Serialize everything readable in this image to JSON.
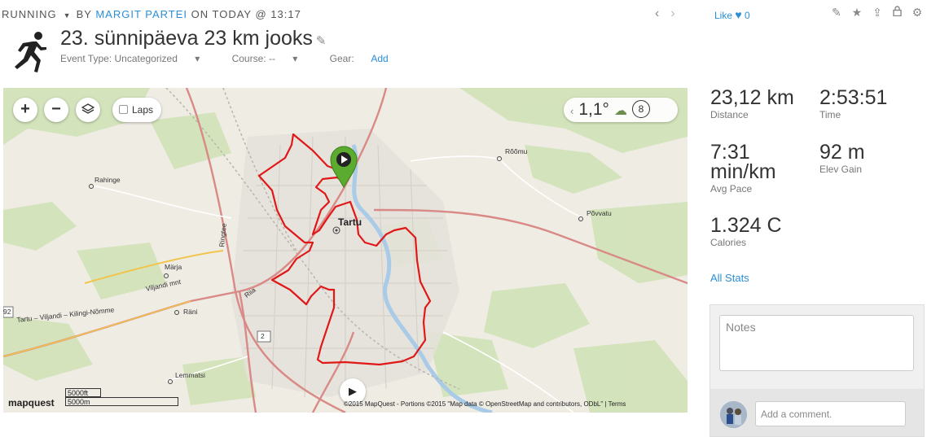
{
  "header": {
    "sport": "RUNNING",
    "by": "BY",
    "author": "MARGIT PARTEI",
    "when": "ON TODAY @ 13:17",
    "prev_icon": "chevron-left-icon",
    "next_icon": "chevron-right-icon",
    "like_label": "Like",
    "like_count": "0",
    "title": "23. sünnipäeva 23 km jooks",
    "event_type": "Event Type: Uncategorized",
    "course": "Course: --",
    "gear_label": "Gear:",
    "gear_add": "Add",
    "tool_icons": [
      "pencil-icon",
      "star-icon",
      "share-icon",
      "lock-icon",
      "gear-icon"
    ]
  },
  "map": {
    "zoom_in": "+",
    "zoom_out": "−",
    "laps_label": "Laps",
    "temperature": "1,1°",
    "wind": "8",
    "labels": {
      "city": "Tartu",
      "roomu": "Rõõmu",
      "povvatu": "Põvvatu",
      "rahinge": "Rahinge",
      "marja": "Märja",
      "rani": "Räni",
      "lemmatsi": "Lemmatsi",
      "ringtee": "Ringtee",
      "riia": "Riia",
      "road2a": "2",
      "road2b": "2",
      "viljandi_mnt": "Viljandi mnt",
      "west_road": "Tartu – Viljandi – Kilingi-Nõmme",
      "west_num": "92"
    },
    "scale_ft": "5000ft",
    "scale_m": "5000m",
    "logo": "mapquest",
    "attribution": "©2015 MapQuest - Portions ©2015 \"Map data © OpenStreetMap and contributors, ODbL\" | Terms"
  },
  "stats": {
    "distance": {
      "value": "23,12 km",
      "label": "Distance"
    },
    "time": {
      "value": "2:53:51",
      "label": "Time"
    },
    "pace": {
      "value": "7:31\nmin/km",
      "value_line1": "7:31",
      "value_line2": "min/km",
      "label": "Avg Pace"
    },
    "elev": {
      "value": "92 m",
      "label": "Elev Gain"
    },
    "calories": {
      "value": "1.324 C",
      "label": "Calories"
    },
    "all_stats": "All Stats"
  },
  "notes_placeholder": "Notes",
  "comment_placeholder": "Add a comment.",
  "colors": {
    "accent": "#2a8fd8",
    "route": "#e01818",
    "marker": "#5aab2f"
  }
}
